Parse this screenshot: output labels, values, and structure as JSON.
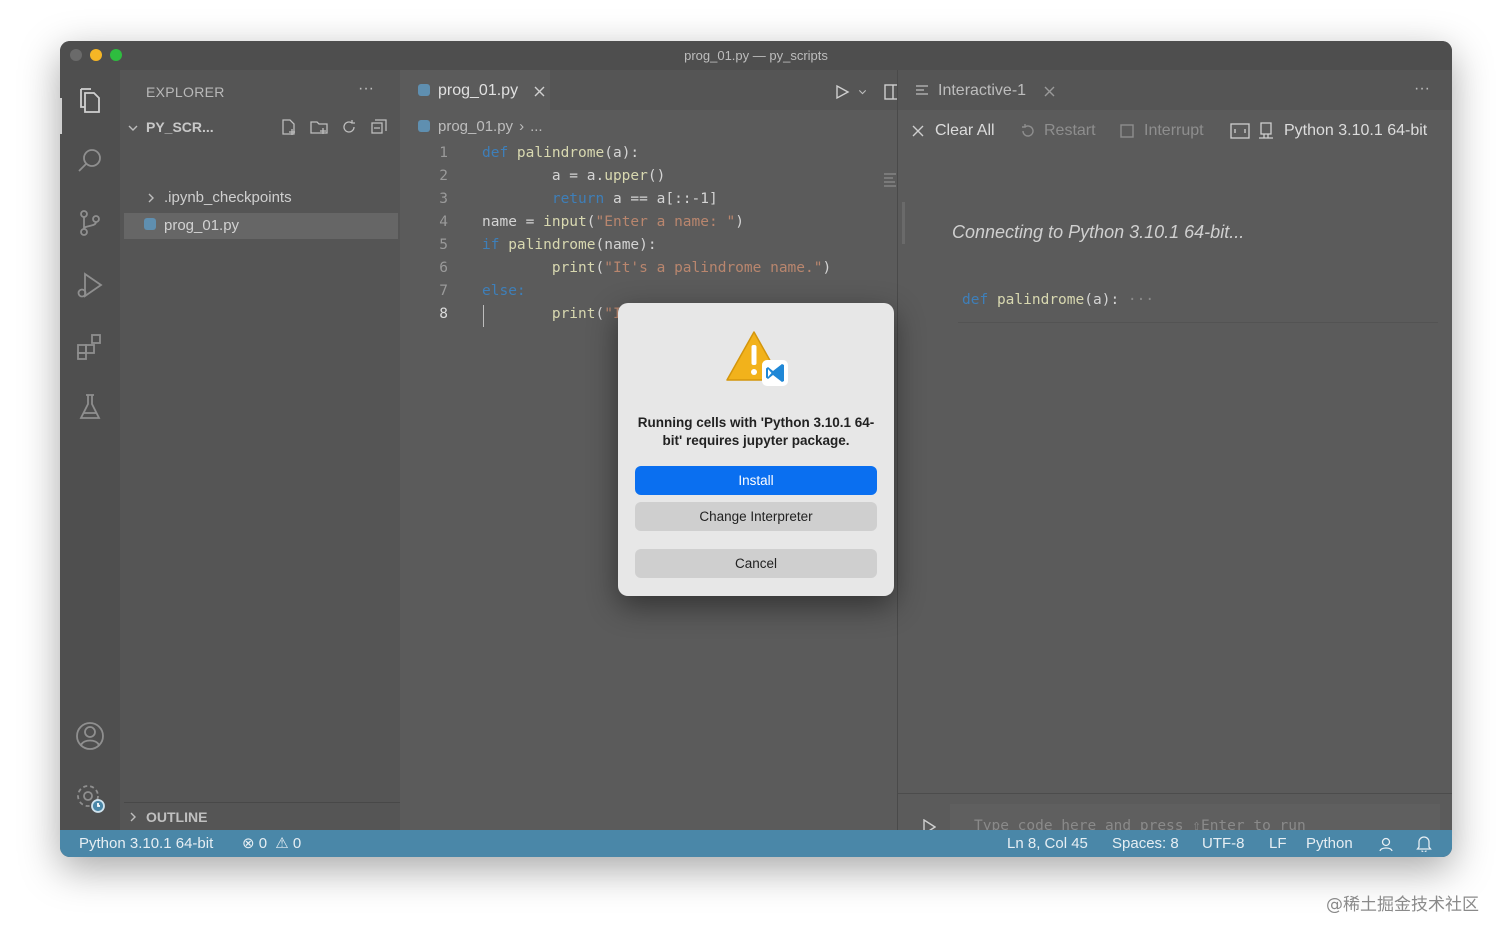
{
  "window": {
    "title": "prog_01.py — py_scripts"
  },
  "sidebar": {
    "header": "EXPLORER",
    "more": "···",
    "folder": "PY_SCR...",
    "items": [
      {
        "label": ".ipynb_checkpoints"
      },
      {
        "label": "prog_01.py"
      }
    ],
    "outline": "OUTLINE"
  },
  "editor": {
    "tab": "prog_01.py",
    "breadcrumb_file": "prog_01.py",
    "breadcrumb_more": "...",
    "line_numbers": [
      "1",
      "2",
      "3",
      "4",
      "5",
      "6",
      "7",
      "8"
    ],
    "code": [
      [
        {
          "t": "def ",
          "c": "kw"
        },
        {
          "t": "palindrome",
          "c": "fn"
        },
        {
          "t": "(a):",
          "c": "plain"
        }
      ],
      [
        {
          "t": "        a = a.",
          "c": "plain"
        },
        {
          "t": "upper",
          "c": "fn"
        },
        {
          "t": "()",
          "c": "plain"
        }
      ],
      [
        {
          "t": "        ",
          "c": "plain"
        },
        {
          "t": "return",
          "c": "kw"
        },
        {
          "t": " a == a[::-1]",
          "c": "plain"
        }
      ],
      [
        {
          "t": "name = ",
          "c": "plain"
        },
        {
          "t": "input",
          "c": "fn"
        },
        {
          "t": "(",
          "c": "plain"
        },
        {
          "t": "\"Enter a name: \"",
          "c": "str"
        },
        {
          "t": ")",
          "c": "plain"
        }
      ],
      [
        {
          "t": "if ",
          "c": "kw"
        },
        {
          "t": "palindrome",
          "c": "fn"
        },
        {
          "t": "(name):",
          "c": "plain"
        }
      ],
      [
        {
          "t": "        ",
          "c": "plain"
        },
        {
          "t": "print",
          "c": "fn"
        },
        {
          "t": "(",
          "c": "plain"
        },
        {
          "t": "\"It's a palindrome name.\"",
          "c": "str"
        },
        {
          "t": ")",
          "c": "plain"
        }
      ],
      [
        {
          "t": "else:",
          "c": "kw"
        }
      ],
      [
        {
          "t": "        ",
          "c": "plain"
        },
        {
          "t": "print",
          "c": "fn"
        },
        {
          "t": "(",
          "c": "plain"
        },
        {
          "t": "\"It's n",
          "c": "str"
        }
      ]
    ]
  },
  "interactive": {
    "tab": "Interactive-1",
    "more": "···",
    "toolbar": {
      "clear_all": "Clear All",
      "restart": "Restart",
      "interrupt": "Interrupt",
      "kernel": "Python 3.10.1 64-bit"
    },
    "connecting": "Connecting to Python 3.10.1 64-bit...",
    "cell_def": "def",
    "cell_fn": "palindrome",
    "cell_rest": "(a):",
    "cell_more": "···",
    "input_placeholder": "Type code here and press ⇧Enter to run"
  },
  "dialog": {
    "message": "Running cells with 'Python 3.10.1 64-bit' requires jupyter package.",
    "install": "Install",
    "change": "Change Interpreter",
    "cancel": "Cancel"
  },
  "statusbar": {
    "interpreter": "Python 3.10.1 64-bit",
    "errors": "0",
    "warnings": "0",
    "position": "Ln 8, Col 45",
    "spaces": "Spaces: 8",
    "encoding": "UTF-8",
    "eol": "LF",
    "language": "Python"
  },
  "watermark": "@稀土掘金技术社区",
  "colors": {
    "accent": "#0a6ff0",
    "statusbar": "#4a87a8"
  }
}
